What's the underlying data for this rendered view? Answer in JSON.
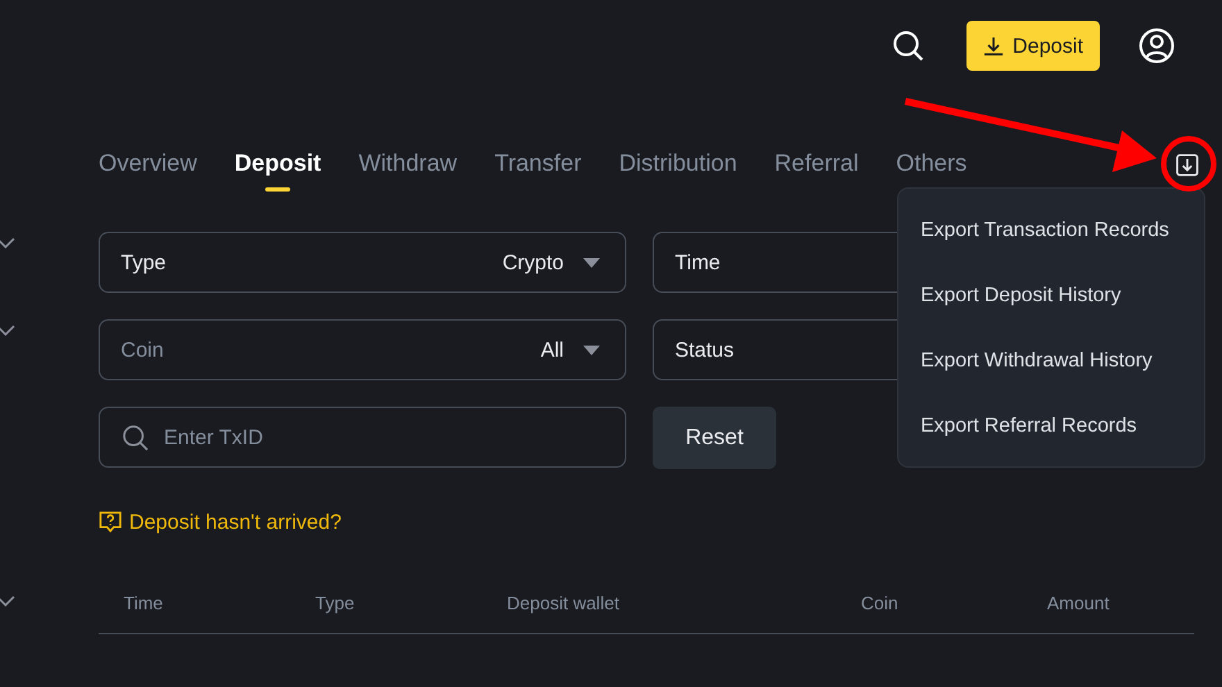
{
  "header": {
    "deposit_button": "Deposit"
  },
  "tabs": [
    {
      "label": "Overview",
      "selected": false
    },
    {
      "label": "Deposit",
      "selected": true
    },
    {
      "label": "Withdraw",
      "selected": false
    },
    {
      "label": "Transfer",
      "selected": false
    },
    {
      "label": "Distribution",
      "selected": false
    },
    {
      "label": "Referral",
      "selected": false
    },
    {
      "label": "Others",
      "selected": false
    }
  ],
  "filters": [
    {
      "kind": "select",
      "label": "Type",
      "value": "Crypto"
    },
    {
      "kind": "select",
      "label": "Time"
    },
    {
      "kind": "combo",
      "placeholder": "Coin",
      "value": "All"
    },
    {
      "kind": "select",
      "label": "Status"
    },
    {
      "kind": "search",
      "placeholder": "Enter TxID"
    },
    {
      "kind": "button",
      "label": "Reset"
    }
  ],
  "help_link": "Deposit hasn't arrived?",
  "table": {
    "columns": [
      "Time",
      "Type",
      "Deposit wallet",
      "Coin",
      "Amount"
    ]
  },
  "export_menu": {
    "items": [
      "Export Transaction Records",
      "Export Deposit History",
      "Export Withdrawal History",
      "Export Referral Records"
    ]
  }
}
